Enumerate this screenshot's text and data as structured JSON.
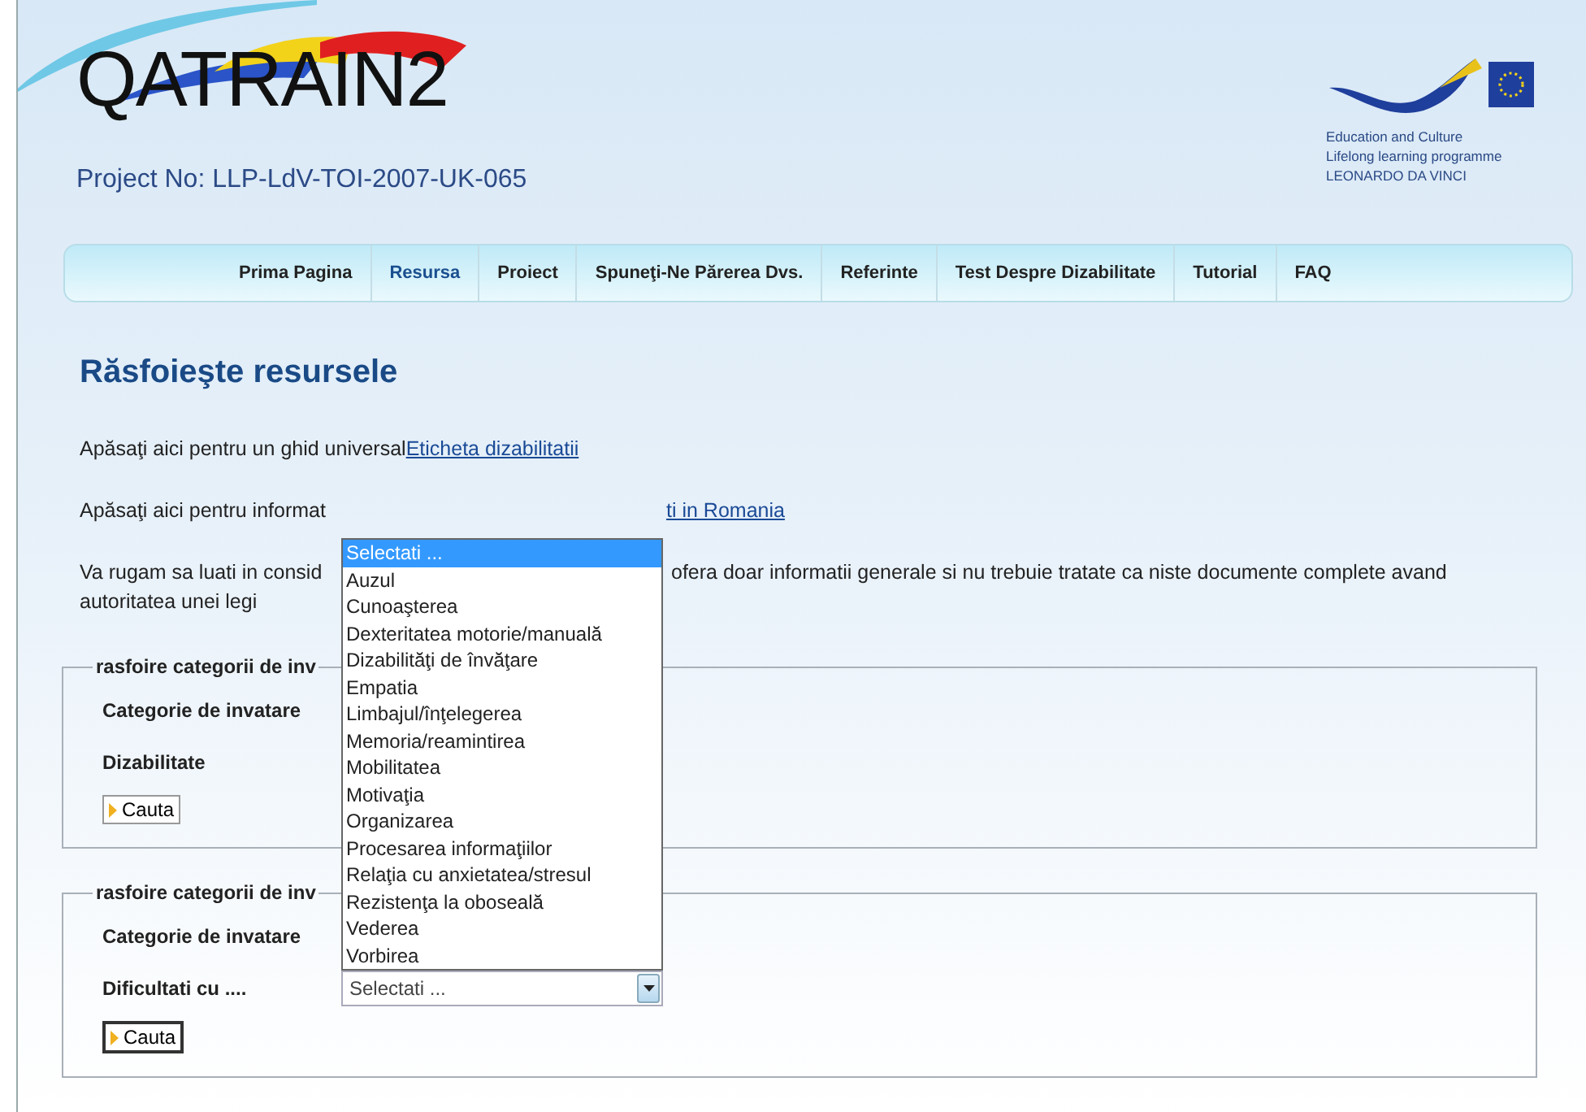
{
  "header": {
    "logo": "QATRAIN2",
    "project": "Project No: LLP-LdV-TOI-2007-UK-065",
    "partner_lines": [
      "Education and Culture",
      "Lifelong learning programme",
      "LEONARDO DA VINCI"
    ]
  },
  "nav": [
    {
      "label": "Prima Pagina",
      "selected": false
    },
    {
      "label": "Resursa",
      "selected": true
    },
    {
      "label": "Proiect",
      "selected": false
    },
    {
      "label": "Spuneţi-Ne Părerea Dvs.",
      "selected": false
    },
    {
      "label": "Referinte",
      "selected": false
    },
    {
      "label": "Test Despre Dizabilitate",
      "selected": false
    },
    {
      "label": "Tutorial",
      "selected": false
    },
    {
      "label": "FAQ",
      "selected": false
    }
  ],
  "heading": "Răsfoieşte resursele",
  "intro": {
    "text": "Apăsaţi aici pentru un ghid universal",
    "link": "Eticheta dizabilitatii"
  },
  "legislation": {
    "text": "Apăsaţi aici pentru informat",
    "link": "ti in Romania"
  },
  "notice": {
    "start": "Va rugam sa luati in consid",
    "rest": "ofera doar informatii generale si nu trebuie tratate ca niste documente complete avand",
    "end": "autoritatea unei legi"
  },
  "forms": [
    {
      "legend": "rasfoire categorii de inv",
      "fields": [
        {
          "label": "Categorie de invatare"
        },
        {
          "label": "Dizabilitate"
        }
      ],
      "button": "Cauta",
      "focused": false
    },
    {
      "legend": "rasfoire categorii de inv",
      "fields": [
        {
          "label": "Categorie de invatare"
        },
        {
          "label": "Dificultati cu ....",
          "value": "Selectati ..."
        }
      ],
      "button": "Cauta",
      "focused": true
    }
  ],
  "dropdown": {
    "options": [
      {
        "label": "Selectati ...",
        "selected": true
      },
      {
        "label": "Auzul",
        "selected": false
      },
      {
        "label": "Cunoaşterea",
        "selected": false
      },
      {
        "label": "Dexteritatea motorie/manuală",
        "selected": false
      },
      {
        "label": "Dizabilităţi de învăţare",
        "selected": false
      },
      {
        "label": "Empatia",
        "selected": false
      },
      {
        "label": "Limbajul/înţelegerea",
        "selected": false
      },
      {
        "label": "Memoria/reamintirea",
        "selected": false
      },
      {
        "label": "Mobilitatea",
        "selected": false
      },
      {
        "label": "Motivaţia",
        "selected": false
      },
      {
        "label": "Organizarea",
        "selected": false
      },
      {
        "label": "Procesarea informaţiilor",
        "selected": false
      },
      {
        "label": "Relaţia cu anxietatea/stresul",
        "selected": false
      },
      {
        "label": "Rezistenţa la oboseală",
        "selected": false
      },
      {
        "label": "Vederea",
        "selected": false
      },
      {
        "label": "Vorbirea",
        "selected": false
      }
    ]
  }
}
